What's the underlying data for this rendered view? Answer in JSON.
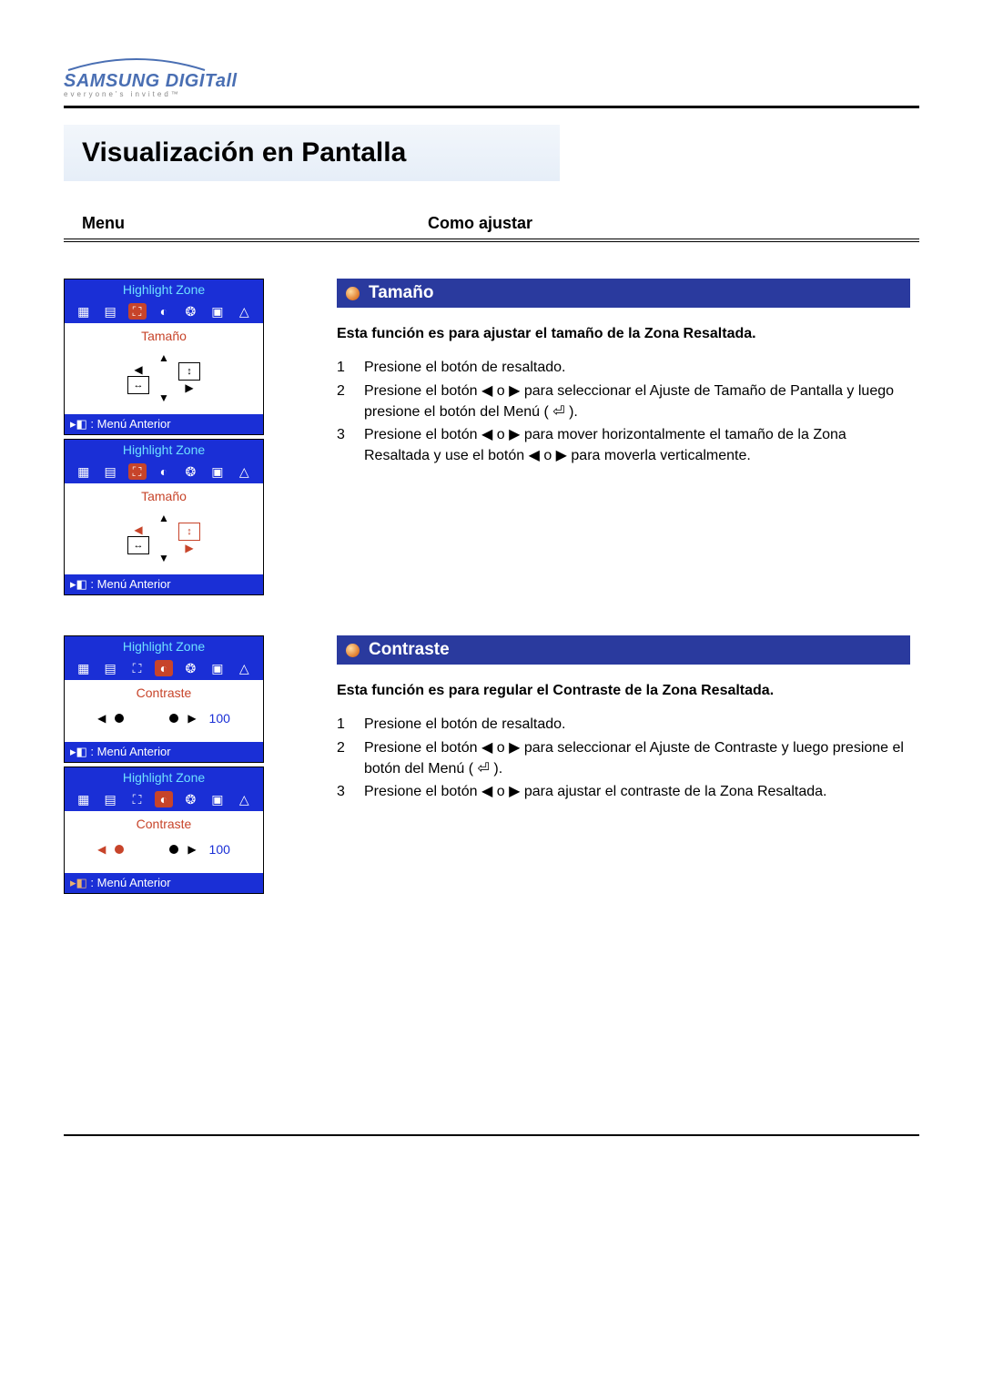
{
  "brand": {
    "name": "SAMSUNG DIGITall",
    "tagline": "everyone's invited™"
  },
  "page_title": "Visualización en Pantalla",
  "headers": {
    "left": "Menu",
    "right": "Como ajustar"
  },
  "osd_common": {
    "title": "Highlight Zone",
    "footer": "Menú Anterior"
  },
  "sections": [
    {
      "id": "tamano",
      "title": "Tamaño",
      "intro": "Esta función es para ajustar el tamaño de la Zona Resaltada.",
      "steps": [
        "Presione el botón de resaltado.",
        "Presione el botón ◀ o ▶ para seleccionar el Ajuste de Tamaño de Pantalla y luego presione el botón del Menú ( ⏎ ).",
        "Presione el botón ◀ o ▶ para mover horizontalmente el tamaño de la Zona Resaltada y use el botón ◀ o ▶ para moverla verticalmente."
      ],
      "osd_label": "Tamaño"
    },
    {
      "id": "contraste",
      "title": "Contraste",
      "intro": "Esta función es para regular el Contraste de la Zona Resaltada.",
      "steps": [
        "Presione el botón de resaltado.",
        "Presione el botón ◀ o ▶ para seleccionar el Ajuste de Contraste y luego presione el botón del Menú ( ⏎ ).",
        "Presione el botón ◀ o ▶ para ajustar el contraste de la Zona Resaltada."
      ],
      "osd_label": "Contraste",
      "osd_value": "100"
    }
  ]
}
